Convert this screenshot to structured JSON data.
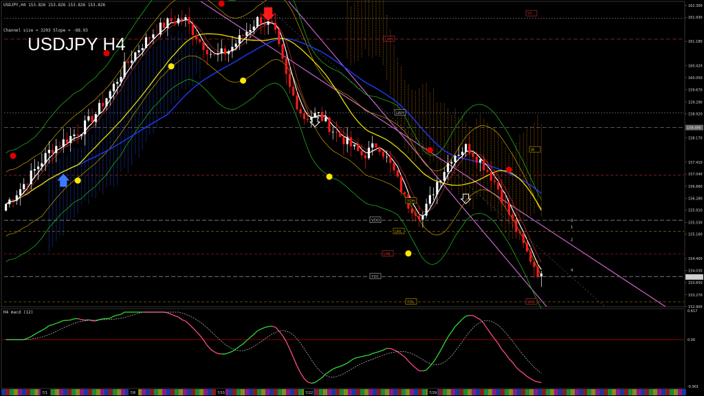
{
  "header": {
    "symbol_line": "USDJPY,H4  153.826 153.826 153.826 153.826",
    "channel_info": "Channel size = 3293 Slope = -88.93",
    "title": "USDJPY H4"
  },
  "macd_panel": {
    "label": "H4  macd (12)",
    "scale_top": "0.617",
    "scale_mid": "0.00",
    "scale_bottom": "-0.901"
  },
  "price_axis": {
    "ticks": [
      "162.300",
      "161.930",
      "161.180",
      "160.420",
      "160.050",
      "159.670",
      "159.290",
      "158.920",
      "158.170",
      "157.410",
      "157.040",
      "156.660",
      "156.280",
      "155.910",
      "155.530",
      "155.160",
      "154.400",
      "154.030",
      "153.650",
      "153.270",
      "152.900"
    ],
    "current_price": "153.826",
    "current_highlight": "158.490"
  },
  "date_axis": {
    "labels": [
      "7/1",
      "7/8",
      "7/15",
      "7/22",
      "7/29"
    ]
  },
  "level_labels": {
    "vdo": "VDO",
    "ydc": "YDC",
    "ydl": "YDL",
    "ydh": "YDH",
    "lwl": "LWL",
    "lml": "LML",
    "lwh": "LWH",
    "lmh": "LMH",
    "ww": "WW",
    "yy": "YY",
    "wd": "W"
  },
  "channel_numbers": [
    "3",
    "1",
    "2",
    "4"
  ],
  "colors": {
    "bull": "#ffffff",
    "bear": "#ff1a1a",
    "ma_fast": "#ffffff",
    "ma_mid": "#e8e000",
    "ma_slow": "#1f3bff",
    "envelope": "#1fae1f",
    "channel": "#cc66cc",
    "macd": "#33dd33",
    "macd_neg": "#ff4d88",
    "signal": "#cccccc",
    "cloud": "#c97800"
  },
  "chart_data": {
    "type": "line",
    "title": "USDJPY H4",
    "xlabel": "",
    "ylabel": "",
    "ylim": [
      152.9,
      162.3
    ],
    "x": [
      "7/1",
      "7/8",
      "7/15",
      "7/22",
      "7/29"
    ],
    "series": [
      {
        "name": "",
        "values": [
          156.1,
          158.9,
          161.9,
          153.5,
          157.9,
          153.8
        ]
      }
    ],
    "price_path": [
      156.1,
      156.6,
      157.2,
      157.8,
      158.1,
      158.4,
      158.9,
      159.6,
      160.4,
      161.0,
      161.5,
      161.8,
      161.9,
      161.2,
      160.7,
      160.9,
      161.4,
      161.9,
      161.6,
      159.8,
      158.8,
      158.9,
      158.4,
      158.0,
      157.6,
      158.0,
      157.2,
      156.1,
      155.7,
      156.8,
      157.6,
      157.9,
      157.4,
      156.7,
      155.6,
      154.6,
      153.8
    ],
    "grid": false
  }
}
